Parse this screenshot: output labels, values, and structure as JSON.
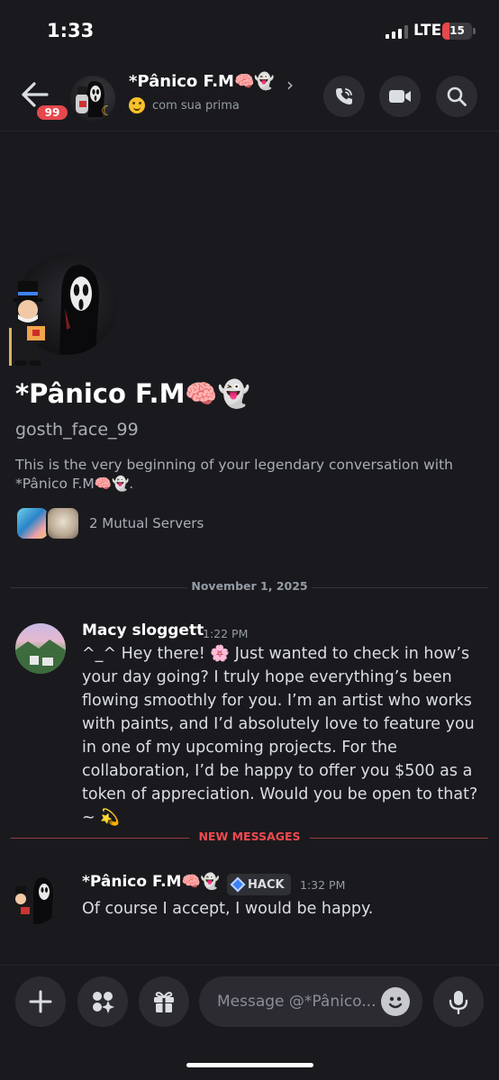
{
  "status_bar": {
    "time": "1:33",
    "network": "LTE",
    "battery": "15",
    "battery_level": 0.15
  },
  "header": {
    "unread_badge": "99",
    "name": "*Pânico F.M🧠👻",
    "status_text": "com sua prima",
    "status_emoji": "smiling-face",
    "icons": [
      "back-arrow-icon",
      "chevron-right-icon",
      "phone-icon",
      "video-icon",
      "search-icon"
    ]
  },
  "intro": {
    "display_name": "*Pânico F.M🧠👻",
    "username": "gosth_face_99",
    "description": "This is the very beginning of your legendary conversation with *Pânico F.M🧠👻.",
    "mutual_servers": "2 Mutual Servers"
  },
  "date_divider": "November 1, 2025",
  "new_messages_label": "NEW MESSAGES",
  "messages": [
    {
      "author": "Macy sloggett",
      "time": "1:22 PM",
      "text": "^_^ Hey there! 🌸 Just wanted to check in how’s your day going? I truly hope everything’s been flowing smoothly for you. I’m an artist who works with paints, and I’d absolutely love to feature you in one of my upcoming projects. For the collaboration, I’d be happy to offer you $500 as a token of appreciation. Would you be open to that?~ 💫"
    },
    {
      "author": "*Pânico F.M🧠👻",
      "tag": "HACK",
      "time": "1:32 PM",
      "text": "Of course I accept, I would be happy."
    }
  ],
  "composer": {
    "placeholder": "Message @*Pânico...",
    "icons": [
      "plus-icon",
      "apps-icon",
      "gift-icon",
      "emoji-icon",
      "microphone-icon"
    ]
  },
  "colors": {
    "background": "#1a1a1e",
    "accent_red": "#e5484d",
    "button_bg": "#2b2b31"
  }
}
